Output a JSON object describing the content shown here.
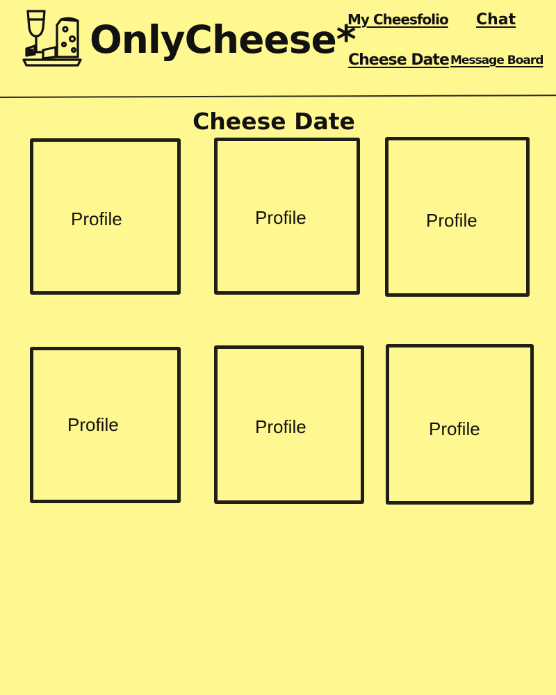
{
  "header": {
    "brand": "OnlyCheese*",
    "logo_icon": "wine-and-cheese-icon",
    "nav": {
      "my_cheesfolio": "My Cheesfolio",
      "chat": "Chat",
      "cheese_date": "Cheese Date",
      "message_board": "Message Board"
    }
  },
  "main": {
    "title": "Cheese Date",
    "profiles": [
      {
        "label": "Profile"
      },
      {
        "label": "Profile"
      },
      {
        "label": "Profile"
      },
      {
        "label": "Profile"
      },
      {
        "label": "Profile"
      },
      {
        "label": "Profile"
      }
    ]
  },
  "colors": {
    "background": "#fff78f",
    "ink": "#1f1f16"
  }
}
